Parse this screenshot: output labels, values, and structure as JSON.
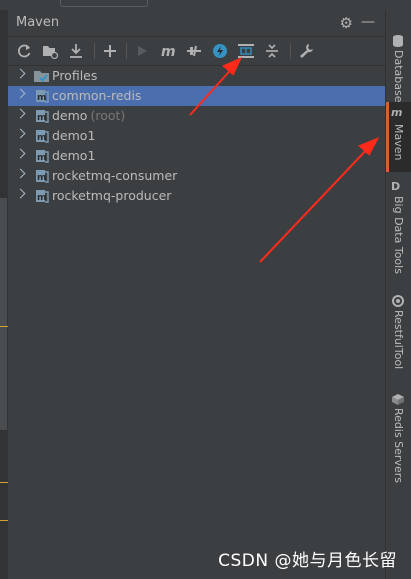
{
  "window": {
    "title": "Maven"
  },
  "toolbar": {
    "buttons": [
      {
        "name": "reload-all-projects-icon"
      },
      {
        "name": "generate-sources-icon"
      },
      {
        "name": "download-sources-icon"
      },
      {
        "name": "add-maven-project-icon"
      },
      {
        "name": "run-maven-build-icon"
      },
      {
        "name": "execute-maven-goal-icon"
      },
      {
        "name": "toggle-offline-mode-icon"
      },
      {
        "name": "toggle-skip-tests-icon"
      },
      {
        "name": "show-dependencies-icon"
      },
      {
        "name": "collapse-all-icon"
      },
      {
        "name": "maven-settings-icon"
      }
    ]
  },
  "tree": {
    "items": [
      {
        "label": "Profiles",
        "suffix": "",
        "icon": "profiles-folder-icon",
        "selected": false
      },
      {
        "label": "common-redis",
        "suffix": "",
        "icon": "maven-module-icon",
        "selected": true
      },
      {
        "label": "demo",
        "suffix": "(root)",
        "icon": "maven-module-icon",
        "selected": false
      },
      {
        "label": "demo1",
        "suffix": "",
        "icon": "maven-module-icon",
        "selected": false
      },
      {
        "label": "demo1",
        "suffix": "",
        "icon": "maven-module-icon",
        "selected": false
      },
      {
        "label": "rocketmq-consumer",
        "suffix": "",
        "icon": "maven-module-icon",
        "selected": false
      },
      {
        "label": "rocketmq-producer",
        "suffix": "",
        "icon": "maven-module-icon",
        "selected": false
      }
    ]
  },
  "sidebar": {
    "tabs": [
      {
        "label": "Database",
        "icon": "",
        "active": false
      },
      {
        "label": "Maven",
        "icon": "m",
        "active": true
      },
      {
        "label": "Big Data Tools",
        "icon": "D",
        "active": false
      },
      {
        "label": "RestfulTool",
        "icon": "",
        "active": false
      },
      {
        "label": "Redis Servers",
        "icon": "",
        "active": false
      }
    ]
  },
  "watermark": "CSDN @她与月色长留",
  "colors": {
    "selection": "#4b6eaf",
    "panel": "#3c3f41",
    "accent_tab": "#d6612e",
    "arrow": "#ff2a1a"
  }
}
